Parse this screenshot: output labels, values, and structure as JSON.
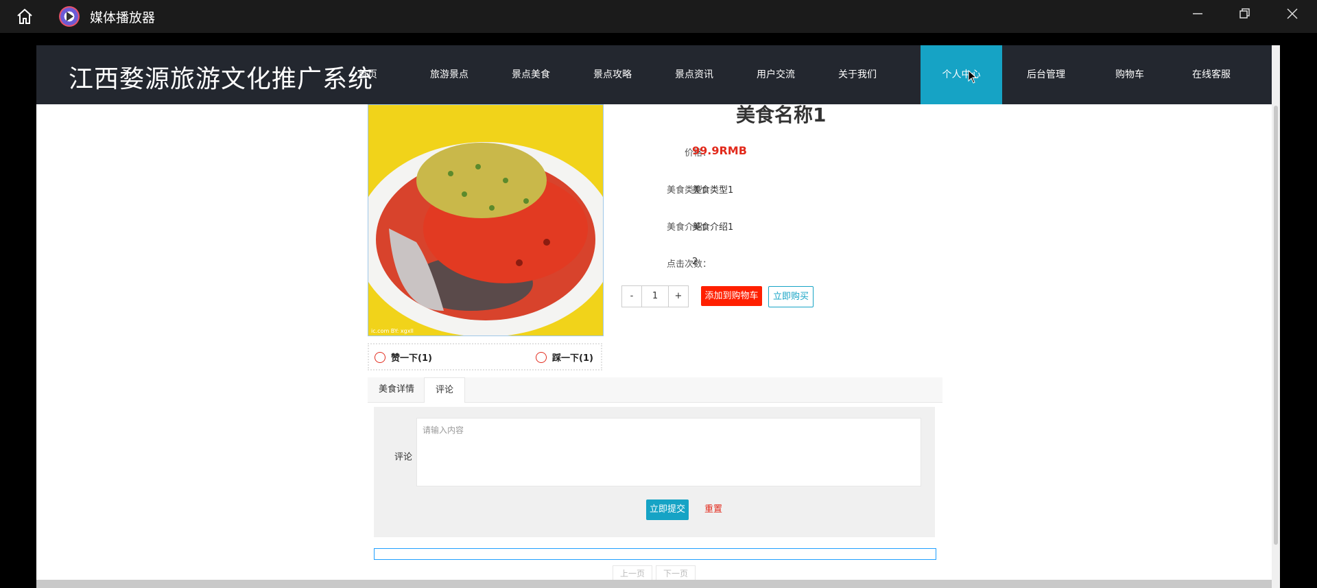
{
  "window": {
    "title": "媒体播放器"
  },
  "site": {
    "title": "江西婺源旅游文化推广系统",
    "nav": [
      "首页",
      "旅游景点",
      "景点美食",
      "景点攻略",
      "景点资讯",
      "用户交流",
      "关于我们",
      "个人中心",
      "后台管理",
      "购物车",
      "在线客服"
    ],
    "active_nav": "个人中心"
  },
  "food": {
    "title": "美食名称1",
    "price_label": "价格：",
    "price": "99.9RMB",
    "type_label": "美食类型：",
    "type": "美食类型1",
    "intro_label": "美食介绍：",
    "intro": "美食介绍1",
    "clicks_label": "点击次数：",
    "clicks": "2",
    "image_watermark": "ic.com BY: xgxll"
  },
  "quantity": {
    "minus": "-",
    "value": "1",
    "plus": "+"
  },
  "actions": {
    "add_to_cart": "添加到购物车",
    "buy_now": "立即购买"
  },
  "votes": {
    "like": "赞一下(1)",
    "dislike": "踩一下(1)"
  },
  "tabs": [
    "美食详情",
    "评论"
  ],
  "active_tab": "评论",
  "comment": {
    "label": "评论",
    "placeholder": "请输入内容",
    "submit": "立即提交",
    "reset": "重置"
  },
  "pager": {
    "prev": "上一页",
    "next": "下一页"
  },
  "colors": {
    "accent": "#16a3c5",
    "danger": "#ff1f00",
    "navbar": "#23272f"
  }
}
